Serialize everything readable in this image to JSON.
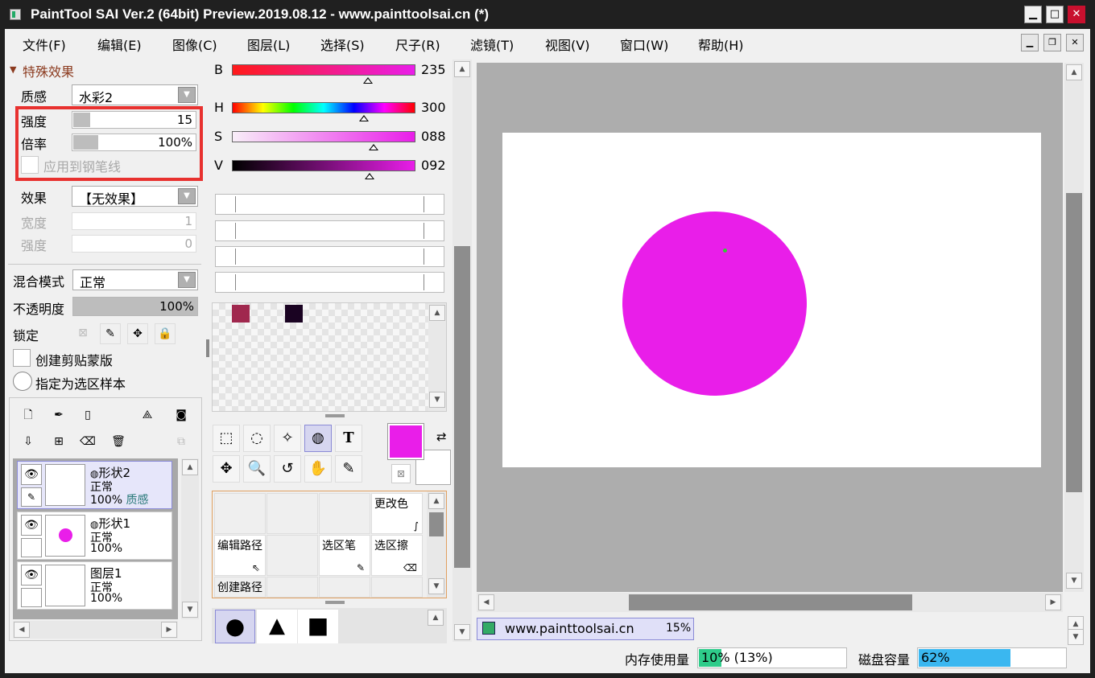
{
  "window": {
    "title": "PaintTool SAI Ver.2 (64bit) Preview.2019.08.12 - www.painttoolsai.cn (*)",
    "minimize_glyph": "▁",
    "maximize_glyph": "□",
    "close_glyph": "✕",
    "close_color": "#c8102e"
  },
  "menu": {
    "items": [
      "文件(F)",
      "编辑(E)",
      "图像(C)",
      "图层(L)",
      "选择(S)",
      "尺子(R)",
      "滤镜(T)",
      "视图(V)",
      "窗口(W)",
      "帮助(H)"
    ],
    "mdi_minimize": "▁",
    "mdi_restore": "❐",
    "mdi_close": "✕"
  },
  "properties": {
    "section_title": "特殊效果",
    "texture_label": "质感",
    "texture_value": "水彩2",
    "strength_label": "强度",
    "strength_value": "15",
    "strength_fill_pct": 15,
    "ratio_label": "倍率",
    "ratio_value": "100%",
    "ratio_fill_pct": 20,
    "apply_pen_label": "应用到钢笔线",
    "effect_label": "效果",
    "effect_value": "【无效果】",
    "width_label": "宽度",
    "width_value": "1",
    "effect_strength_label": "强度",
    "effect_strength_value": "0",
    "blend_label": "混合模式",
    "blend_value": "正常",
    "opacity_label": "不透明度",
    "opacity_value": "100%",
    "lock_label": "锁定",
    "clip_label": "创建剪贴蒙版",
    "sample_label": "指定为选区样本",
    "highlight_color": "#e8312f"
  },
  "layers": [
    {
      "name": "形状2",
      "mode": "正常",
      "opacity": "100%",
      "extra": "质感",
      "selected": true,
      "has_circle": false
    },
    {
      "name": "形状1",
      "mode": "正常",
      "opacity": "100%",
      "extra": "",
      "selected": false,
      "has_circle": true
    },
    {
      "name": "图层1",
      "mode": "正常",
      "opacity": "100%",
      "extra": "",
      "selected": false,
      "has_circle": false
    }
  ],
  "color": {
    "sliders": [
      {
        "label": "B",
        "value": "235",
        "level": 0.74
      },
      {
        "label": "H",
        "value": "300",
        "level": 0.72
      },
      {
        "label": "S",
        "value": "088",
        "level": 0.77
      },
      {
        "label": "V",
        "value": "092",
        "level": 0.75
      }
    ],
    "main_color": "#e91ee9",
    "secondary_color": "#ffffff",
    "swatches": [
      "#a0284e",
      "#1a0322"
    ]
  },
  "tools": {
    "row1": [
      "⬚",
      "◌",
      "✧",
      "◍",
      "T"
    ],
    "row2": [
      "✥",
      "🔍",
      "↺",
      "✋",
      "✎"
    ],
    "brush_cells": {
      "change_color": "更改色",
      "edit_path": "编辑路径",
      "select_pen": "选区笔",
      "select_eraser": "选区擦",
      "create_path": "创建路径"
    },
    "shape_labels": [
      "●",
      "▲",
      "■"
    ]
  },
  "canvas": {
    "shape_color": "#e91ee9",
    "tab_label": "www.painttoolsai.cn",
    "tab_zoom": "15%"
  },
  "status": {
    "memory_label": "内存使用量",
    "memory_value": "10% (13%)",
    "memory_level": 0.1,
    "disk_label": "磁盘容量",
    "disk_value": "62%",
    "disk_level": 0.62
  }
}
